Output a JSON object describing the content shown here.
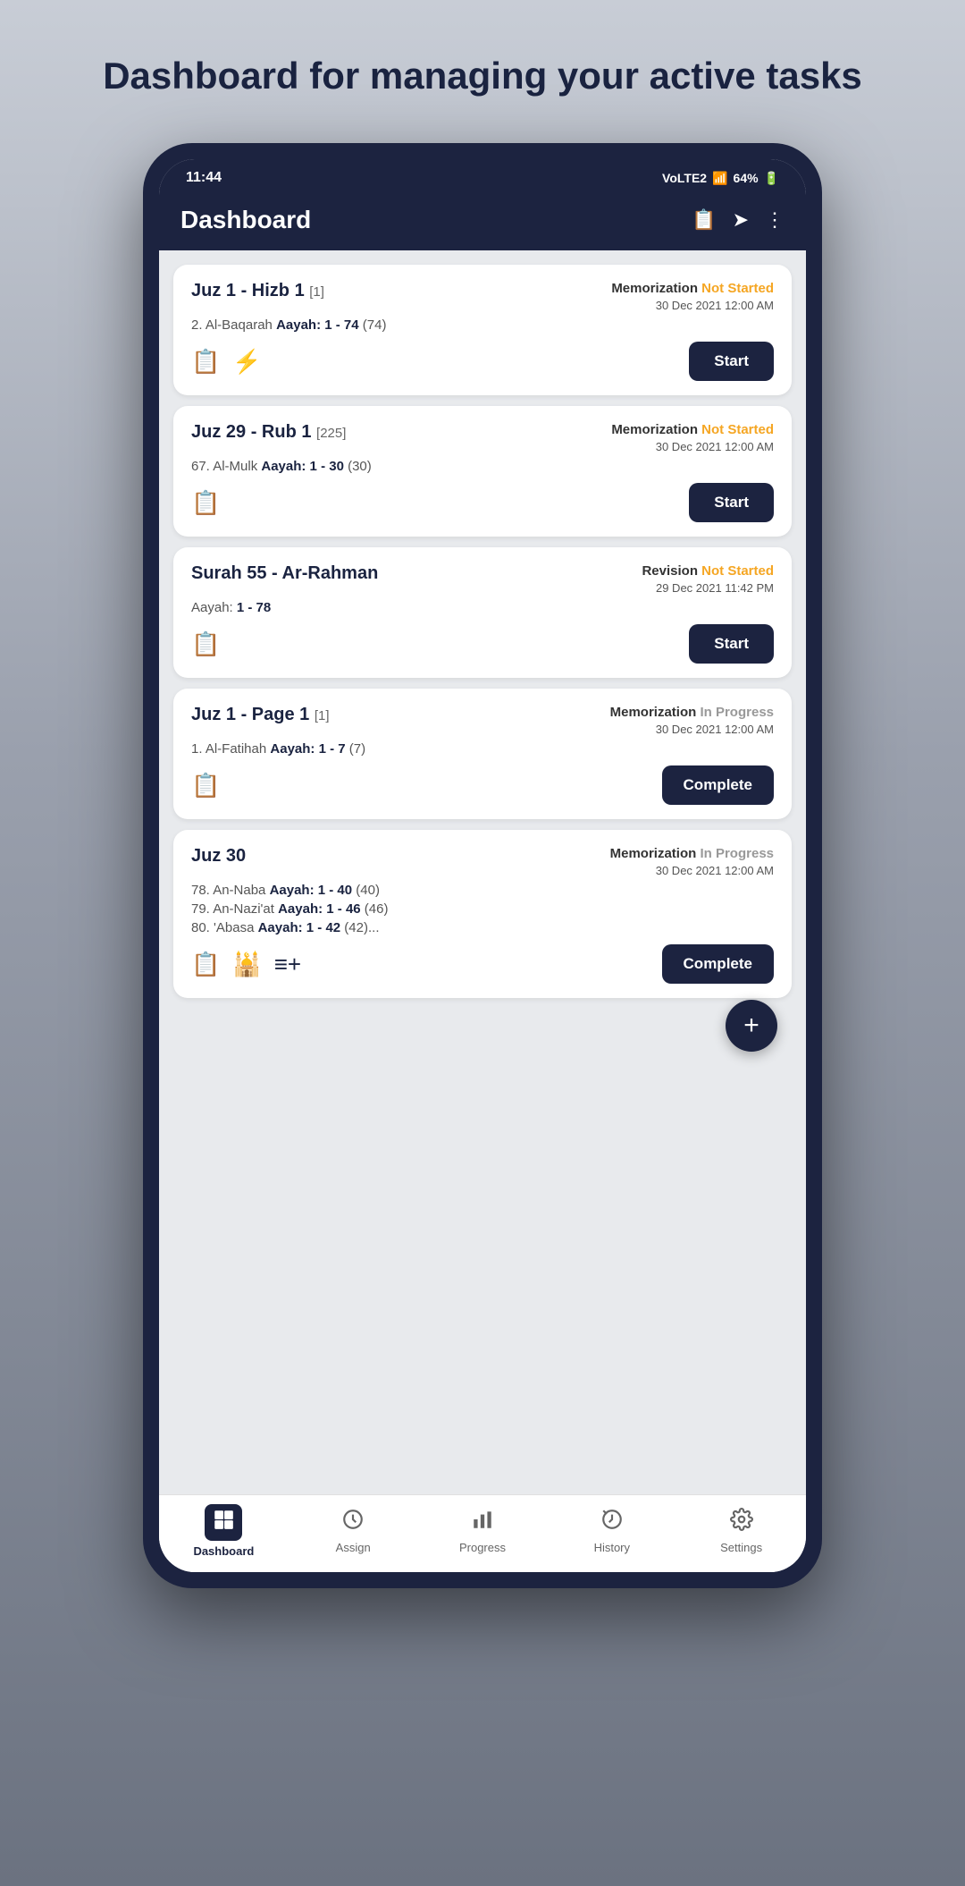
{
  "page": {
    "title": "Dashboard for managing your active tasks"
  },
  "statusBar": {
    "time": "11:44",
    "signal": "VoLTE2",
    "battery": "64%"
  },
  "appHeader": {
    "title": "Dashboard",
    "icons": [
      "clipboard-icon",
      "share-icon",
      "more-icon"
    ]
  },
  "tasks": [
    {
      "id": "task-1",
      "title": "Juz 1 - Hizb 1",
      "titleId": "[1]",
      "subtitle": "2. Al-Baqarah",
      "aayahLabel": "Aayah:",
      "aayahRange": "1 - 74",
      "aayahCount": "(74)",
      "taskType": "Memorization",
      "status": "Not Started",
      "statusClass": "not-started",
      "date": "30 Dec 2021 12:00 AM",
      "icons": [
        "clipboard-icon",
        "lightning-icon"
      ],
      "buttonLabel": "Start",
      "buttonType": "start"
    },
    {
      "id": "task-2",
      "title": "Juz 29 - Rub 1",
      "titleId": "[225]",
      "subtitle": "67. Al-Mulk",
      "aayahLabel": "Aayah:",
      "aayahRange": "1 - 30",
      "aayahCount": "(30)",
      "taskType": "Memorization",
      "status": "Not Started",
      "statusClass": "not-started",
      "date": "30 Dec 2021 12:00 AM",
      "icons": [
        "clipboard-icon"
      ],
      "buttonLabel": "Start",
      "buttonType": "start"
    },
    {
      "id": "task-3",
      "title": "Surah 55 - Ar-Rahman",
      "titleId": "",
      "subtitle": "",
      "aayahLabel": "Aayah:",
      "aayahRange": "1 - 78",
      "aayahCount": "",
      "taskType": "Revision",
      "status": "Not Started",
      "statusClass": "not-started",
      "date": "29 Dec 2021 11:42 PM",
      "icons": [
        "clipboard-icon"
      ],
      "buttonLabel": "Start",
      "buttonType": "start"
    },
    {
      "id": "task-4",
      "title": "Juz 1 - Page 1",
      "titleId": "[1]",
      "subtitle": "1. Al-Fatihah",
      "aayahLabel": "Aayah:",
      "aayahRange": "1 - 7",
      "aayahCount": "(7)",
      "taskType": "Memorization",
      "status": "In Progress",
      "statusClass": "in-progress",
      "date": "30 Dec 2021 12:00 AM",
      "icons": [
        "clipboard-icon"
      ],
      "buttonLabel": "Complete",
      "buttonType": "complete"
    },
    {
      "id": "task-5",
      "title": "Juz 30",
      "titleId": "",
      "subtitleLines": [
        {
          "prefix": "78. An-Naba",
          "label": "Aayah:",
          "range": "1 - 40",
          "count": "(40)"
        },
        {
          "prefix": "79. An-Nazi'at",
          "label": "Aayah:",
          "range": "1 - 46",
          "count": "(46)"
        },
        {
          "prefix": "80. 'Abasa",
          "label": "Aayah:",
          "range": "1 - 42",
          "count": "(42)..."
        }
      ],
      "taskType": "Memorization",
      "status": "In Progress",
      "statusClass": "in-progress",
      "date": "30 Dec 2021 12:00 AM",
      "icons": [
        "clipboard-icon",
        "mosque-icon",
        "add-list-icon"
      ],
      "buttonLabel": "Complete",
      "buttonType": "complete"
    }
  ],
  "fab": {
    "label": "+"
  },
  "bottomNav": [
    {
      "id": "dashboard",
      "label": "Dashboard",
      "icon": "grid-icon",
      "active": true
    },
    {
      "id": "assign",
      "label": "Assign",
      "icon": "clock-icon",
      "active": false
    },
    {
      "id": "progress",
      "label": "Progress",
      "icon": "bar-chart-icon",
      "active": false
    },
    {
      "id": "history",
      "label": "History",
      "icon": "history-icon",
      "active": false
    },
    {
      "id": "settings",
      "label": "Settings",
      "icon": "gear-icon",
      "active": false
    }
  ]
}
